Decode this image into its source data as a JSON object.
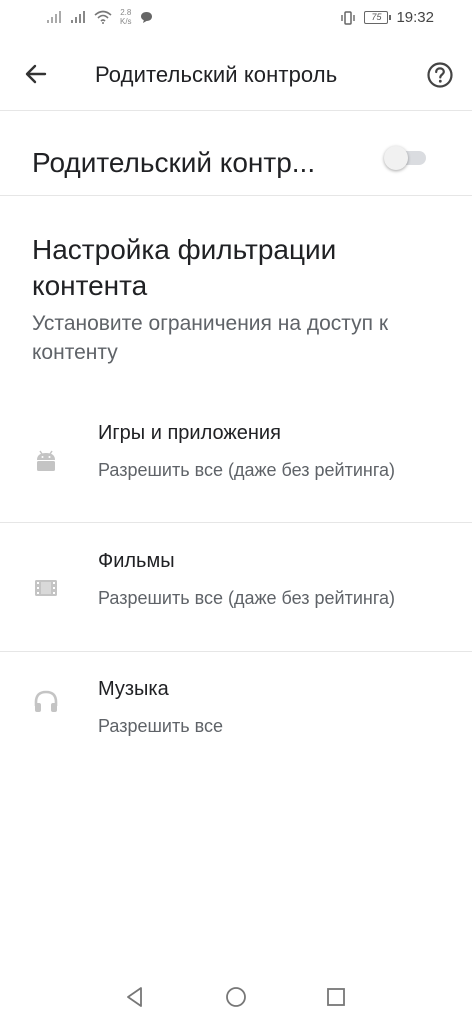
{
  "status_bar": {
    "net_speed_value": "2.8",
    "net_speed_unit": "K/s",
    "battery": "75",
    "time": "19:32"
  },
  "app_bar": {
    "title": "Родительский контроль"
  },
  "parental_toggle": {
    "label": "Родительский контр...",
    "enabled": false
  },
  "filter_section": {
    "title": "Настройка фильтрации контента",
    "subtitle": "Установите ограничения на доступ к контенту"
  },
  "items": [
    {
      "title": "Игры и приложения",
      "subtitle": "Разрешить все (даже без рейтинга)",
      "icon": "android-icon"
    },
    {
      "title": "Фильмы",
      "subtitle": "Разрешить все (даже без рейтинга)",
      "icon": "film-icon"
    },
    {
      "title": "Музыка",
      "subtitle": "Разрешить все",
      "icon": "headphones-icon"
    }
  ],
  "colors": {
    "text_primary": "#202124",
    "text_secondary": "#5f6368",
    "icon_gray": "#bdbdbd",
    "divider": "#e6e6e6"
  }
}
